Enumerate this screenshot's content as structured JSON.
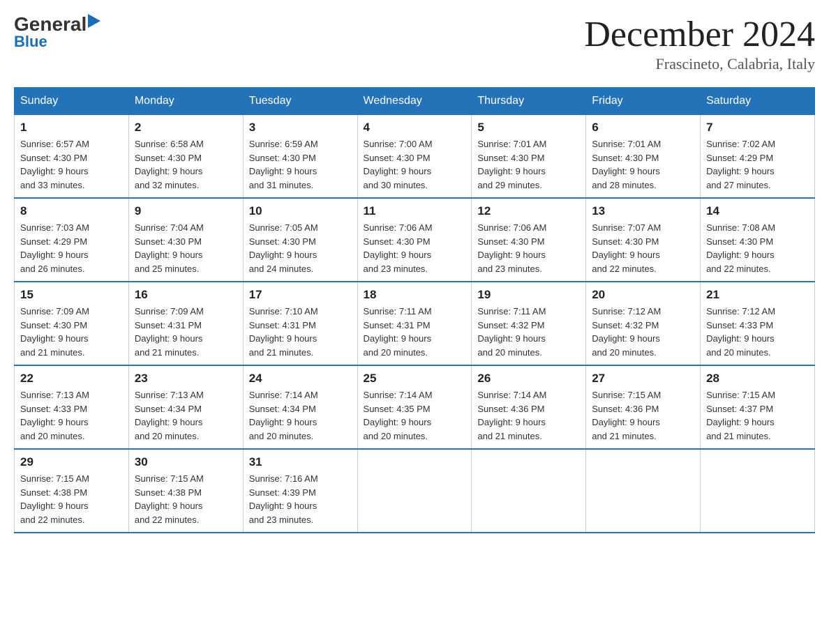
{
  "logo": {
    "general": "General",
    "blue": "Blue",
    "arrow": "▶"
  },
  "title": "December 2024",
  "location": "Frascineto, Calabria, Italy",
  "days_of_week": [
    "Sunday",
    "Monday",
    "Tuesday",
    "Wednesday",
    "Thursday",
    "Friday",
    "Saturday"
  ],
  "weeks": [
    [
      {
        "day": "1",
        "sunrise": "6:57 AM",
        "sunset": "4:30 PM",
        "daylight": "9 hours and 33 minutes."
      },
      {
        "day": "2",
        "sunrise": "6:58 AM",
        "sunset": "4:30 PM",
        "daylight": "9 hours and 32 minutes."
      },
      {
        "day": "3",
        "sunrise": "6:59 AM",
        "sunset": "4:30 PM",
        "daylight": "9 hours and 31 minutes."
      },
      {
        "day": "4",
        "sunrise": "7:00 AM",
        "sunset": "4:30 PM",
        "daylight": "9 hours and 30 minutes."
      },
      {
        "day": "5",
        "sunrise": "7:01 AM",
        "sunset": "4:30 PM",
        "daylight": "9 hours and 29 minutes."
      },
      {
        "day": "6",
        "sunrise": "7:01 AM",
        "sunset": "4:30 PM",
        "daylight": "9 hours and 28 minutes."
      },
      {
        "day": "7",
        "sunrise": "7:02 AM",
        "sunset": "4:29 PM",
        "daylight": "9 hours and 27 minutes."
      }
    ],
    [
      {
        "day": "8",
        "sunrise": "7:03 AM",
        "sunset": "4:29 PM",
        "daylight": "9 hours and 26 minutes."
      },
      {
        "day": "9",
        "sunrise": "7:04 AM",
        "sunset": "4:30 PM",
        "daylight": "9 hours and 25 minutes."
      },
      {
        "day": "10",
        "sunrise": "7:05 AM",
        "sunset": "4:30 PM",
        "daylight": "9 hours and 24 minutes."
      },
      {
        "day": "11",
        "sunrise": "7:06 AM",
        "sunset": "4:30 PM",
        "daylight": "9 hours and 23 minutes."
      },
      {
        "day": "12",
        "sunrise": "7:06 AM",
        "sunset": "4:30 PM",
        "daylight": "9 hours and 23 minutes."
      },
      {
        "day": "13",
        "sunrise": "7:07 AM",
        "sunset": "4:30 PM",
        "daylight": "9 hours and 22 minutes."
      },
      {
        "day": "14",
        "sunrise": "7:08 AM",
        "sunset": "4:30 PM",
        "daylight": "9 hours and 22 minutes."
      }
    ],
    [
      {
        "day": "15",
        "sunrise": "7:09 AM",
        "sunset": "4:30 PM",
        "daylight": "9 hours and 21 minutes."
      },
      {
        "day": "16",
        "sunrise": "7:09 AM",
        "sunset": "4:31 PM",
        "daylight": "9 hours and 21 minutes."
      },
      {
        "day": "17",
        "sunrise": "7:10 AM",
        "sunset": "4:31 PM",
        "daylight": "9 hours and 21 minutes."
      },
      {
        "day": "18",
        "sunrise": "7:11 AM",
        "sunset": "4:31 PM",
        "daylight": "9 hours and 20 minutes."
      },
      {
        "day": "19",
        "sunrise": "7:11 AM",
        "sunset": "4:32 PM",
        "daylight": "9 hours and 20 minutes."
      },
      {
        "day": "20",
        "sunrise": "7:12 AM",
        "sunset": "4:32 PM",
        "daylight": "9 hours and 20 minutes."
      },
      {
        "day": "21",
        "sunrise": "7:12 AM",
        "sunset": "4:33 PM",
        "daylight": "9 hours and 20 minutes."
      }
    ],
    [
      {
        "day": "22",
        "sunrise": "7:13 AM",
        "sunset": "4:33 PM",
        "daylight": "9 hours and 20 minutes."
      },
      {
        "day": "23",
        "sunrise": "7:13 AM",
        "sunset": "4:34 PM",
        "daylight": "9 hours and 20 minutes."
      },
      {
        "day": "24",
        "sunrise": "7:14 AM",
        "sunset": "4:34 PM",
        "daylight": "9 hours and 20 minutes."
      },
      {
        "day": "25",
        "sunrise": "7:14 AM",
        "sunset": "4:35 PM",
        "daylight": "9 hours and 20 minutes."
      },
      {
        "day": "26",
        "sunrise": "7:14 AM",
        "sunset": "4:36 PM",
        "daylight": "9 hours and 21 minutes."
      },
      {
        "day": "27",
        "sunrise": "7:15 AM",
        "sunset": "4:36 PM",
        "daylight": "9 hours and 21 minutes."
      },
      {
        "day": "28",
        "sunrise": "7:15 AM",
        "sunset": "4:37 PM",
        "daylight": "9 hours and 21 minutes."
      }
    ],
    [
      {
        "day": "29",
        "sunrise": "7:15 AM",
        "sunset": "4:38 PM",
        "daylight": "9 hours and 22 minutes."
      },
      {
        "day": "30",
        "sunrise": "7:15 AM",
        "sunset": "4:38 PM",
        "daylight": "9 hours and 22 minutes."
      },
      {
        "day": "31",
        "sunrise": "7:16 AM",
        "sunset": "4:39 PM",
        "daylight": "9 hours and 23 minutes."
      },
      null,
      null,
      null,
      null
    ]
  ]
}
